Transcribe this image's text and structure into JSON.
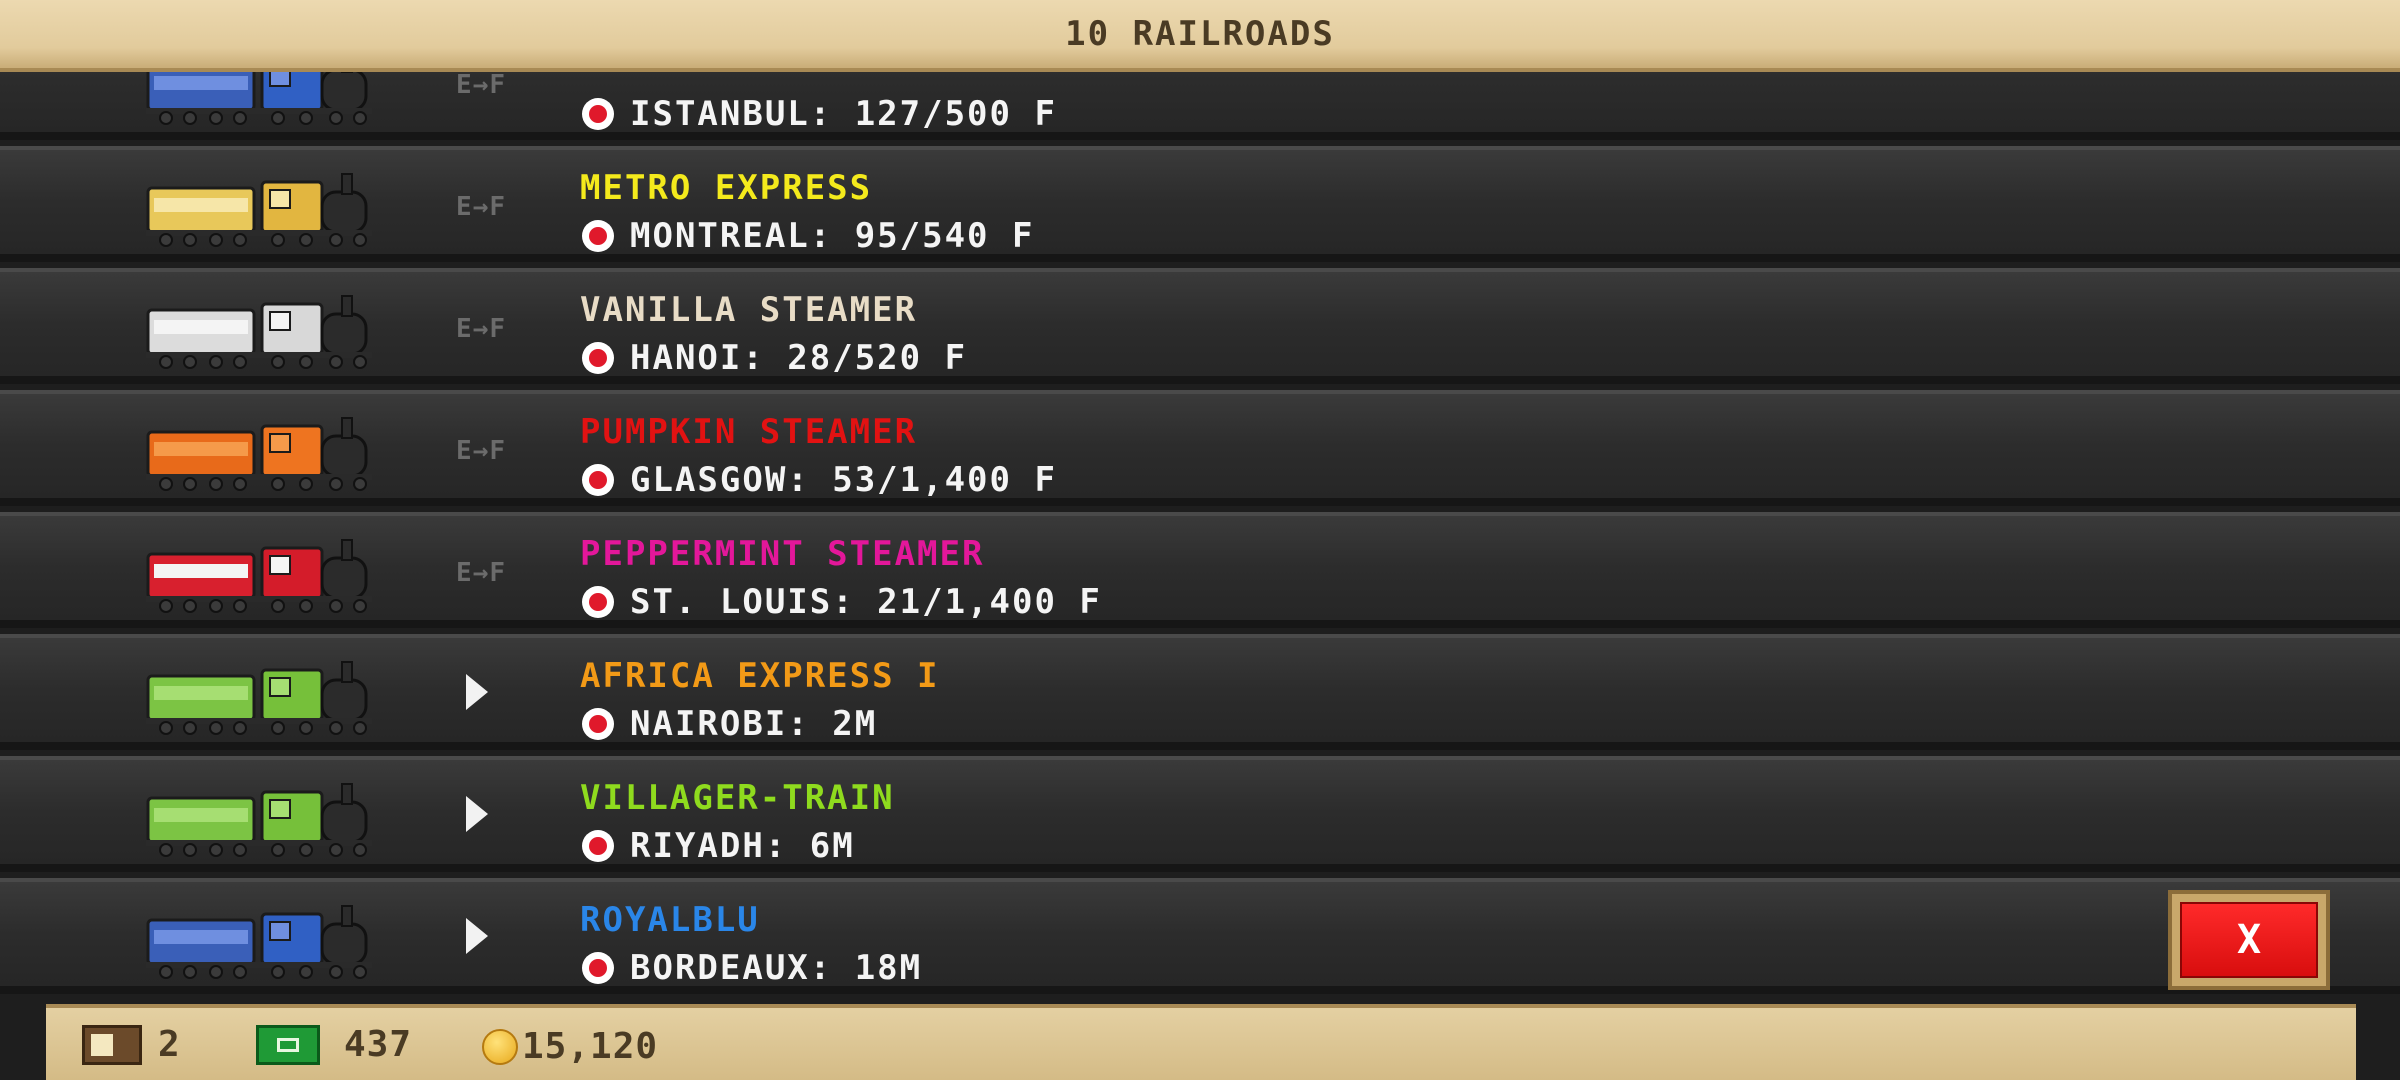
{
  "header": {
    "title": "10 RAILROADS"
  },
  "colors": {
    "metro_express": "#f4ea1c",
    "vanilla_steamer": "#e8dcc6",
    "pumpkin_steamer": "#e21212",
    "peppermint_steamer": "#e3179a",
    "africa_express": "#f29a17",
    "villager_train": "#8fdb1e",
    "royalblu": "#2a86e8"
  },
  "trains": [
    {
      "name": "",
      "destination": "ISTANBUL: 127/500 F",
      "status": "E→F",
      "icon": "blue-steam-train-icon"
    },
    {
      "name": "METRO EXPRESS",
      "destination": "MONTREAL: 95/540 F",
      "status": "E→F",
      "icon": "yellow-diesel-train-icon"
    },
    {
      "name": "VANILLA STEAMER",
      "destination": "HANOI: 28/520 F",
      "status": "E→F",
      "icon": "white-steam-train-icon"
    },
    {
      "name": "PUMPKIN STEAMER",
      "destination": "GLASGOW: 53/1,400 F",
      "status": "E→F",
      "icon": "pumpkin-steam-train-icon"
    },
    {
      "name": "PEPPERMINT STEAMER",
      "destination": "ST. LOUIS: 21/1,400 F",
      "status": "E→F",
      "icon": "peppermint-steam-train-icon"
    },
    {
      "name": "AFRICA EXPRESS I",
      "destination": "NAIROBI: 2M",
      "status": "play",
      "icon": "green-steam-train-icon"
    },
    {
      "name": "VILLAGER-TRAIN",
      "destination": "RIYADH: 6M",
      "status": "play",
      "icon": "green-steam-train-icon"
    },
    {
      "name": "ROYALBLU",
      "destination": "BORDEAUX: 18M",
      "status": "play",
      "icon": "blue-steam-train-icon"
    }
  ],
  "close_button": {
    "label": "X"
  },
  "footer": {
    "crates": "2",
    "cash": "437",
    "coins": "15,120"
  }
}
